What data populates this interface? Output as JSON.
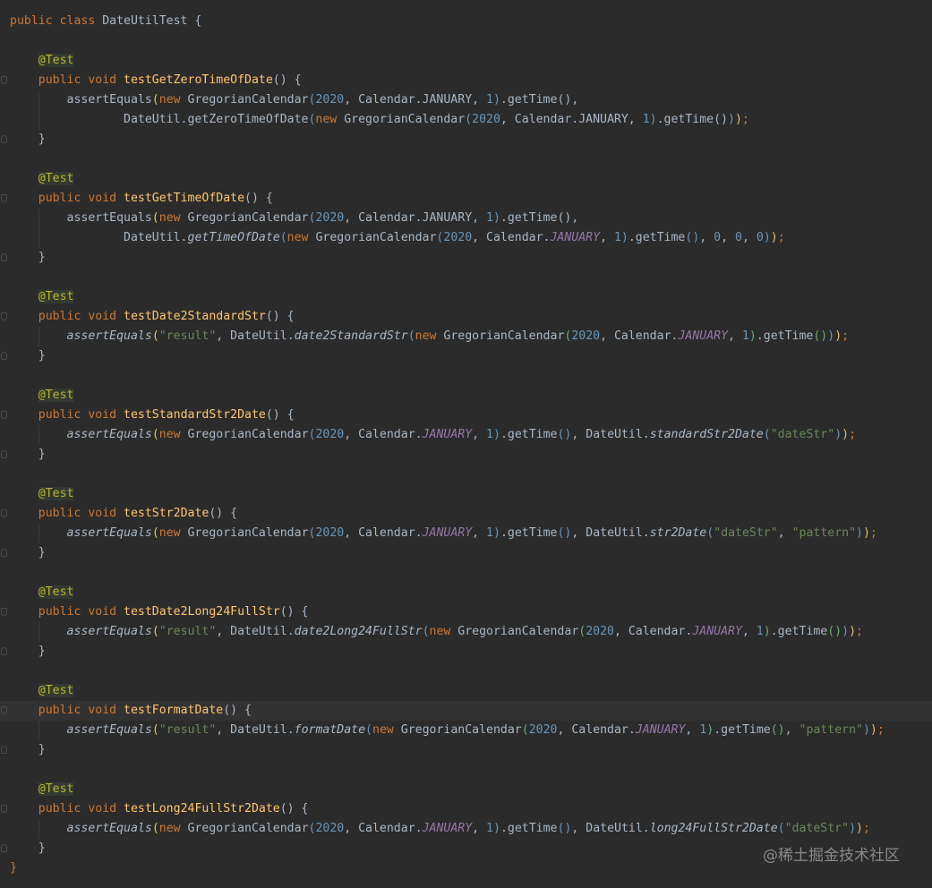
{
  "editor": {
    "current_line": 35,
    "lines": [
      [
        {
          "t": "public class ",
          "c": "keyword"
        },
        {
          "t": "DateUtilTest {",
          "c": "plain"
        }
      ],
      [],
      [
        {
          "t": "    "
        },
        {
          "t": "@Test",
          "c": "annotation"
        }
      ],
      [
        {
          "t": "    "
        },
        {
          "t": "public void ",
          "c": "keyword"
        },
        {
          "t": "testGetZeroTimeOfDate",
          "c": "method"
        },
        {
          "t": "() {",
          "c": "plain"
        }
      ],
      [
        {
          "t": "        assertEquals",
          "c": "plain"
        },
        {
          "t": "(",
          "c": "paren1"
        },
        {
          "t": "new ",
          "c": "keyword"
        },
        {
          "t": "GregorianCalendar",
          "c": "plain"
        },
        {
          "t": "(",
          "c": "paren2"
        },
        {
          "t": "2020",
          "c": "number"
        },
        {
          "t": ", Calendar.JANUARY, ",
          "c": "plain"
        },
        {
          "t": "1",
          "c": "number"
        },
        {
          "t": ")",
          "c": "paren2"
        },
        {
          "t": ".getTime(),",
          "c": "plain"
        }
      ],
      [
        {
          "t": "                DateUtil.getZeroTimeOfDate",
          "c": "plain"
        },
        {
          "t": "(",
          "c": "paren2"
        },
        {
          "t": "new ",
          "c": "keyword"
        },
        {
          "t": "GregorianCalendar",
          "c": "plain"
        },
        {
          "t": "(",
          "c": "paren2"
        },
        {
          "t": "2020",
          "c": "number"
        },
        {
          "t": ", Calendar.JANUARY, ",
          "c": "plain"
        },
        {
          "t": "1",
          "c": "number"
        },
        {
          "t": ")",
          "c": "paren2"
        },
        {
          "t": ".getTime()",
          "c": "plain"
        },
        {
          "t": ")",
          "c": "paren2"
        },
        {
          "t": ")",
          "c": "paren1"
        },
        {
          "t": ";",
          "c": "keyword"
        }
      ],
      [
        {
          "t": "    }",
          "c": "plain"
        }
      ],
      [],
      [
        {
          "t": "    "
        },
        {
          "t": "@Test",
          "c": "annotation"
        }
      ],
      [
        {
          "t": "    "
        },
        {
          "t": "public void ",
          "c": "keyword"
        },
        {
          "t": "testGetTimeOfDate",
          "c": "method"
        },
        {
          "t": "() {",
          "c": "plain"
        }
      ],
      [
        {
          "t": "        assertEquals",
          "c": "plain"
        },
        {
          "t": "(",
          "c": "paren1"
        },
        {
          "t": "new ",
          "c": "keyword"
        },
        {
          "t": "GregorianCalendar",
          "c": "plain"
        },
        {
          "t": "(",
          "c": "paren2"
        },
        {
          "t": "2020",
          "c": "number"
        },
        {
          "t": ", Calendar.JANUARY, ",
          "c": "plain"
        },
        {
          "t": "1",
          "c": "number"
        },
        {
          "t": ")",
          "c": "paren2"
        },
        {
          "t": ".getTime(),",
          "c": "plain"
        }
      ],
      [
        {
          "t": "                DateUtil.",
          "c": "plain"
        },
        {
          "t": "getTimeOfDate",
          "c": "static-method"
        },
        {
          "t": "(",
          "c": "paren2"
        },
        {
          "t": "new ",
          "c": "keyword"
        },
        {
          "t": "GregorianCalendar",
          "c": "plain"
        },
        {
          "t": "(",
          "c": "paren2"
        },
        {
          "t": "2020",
          "c": "number"
        },
        {
          "t": ", Calendar.",
          "c": "plain"
        },
        {
          "t": "JANUARY",
          "c": "static-field"
        },
        {
          "t": ", ",
          "c": "plain"
        },
        {
          "t": "1",
          "c": "number"
        },
        {
          "t": ")",
          "c": "paren2"
        },
        {
          "t": ".getTime",
          "c": "plain"
        },
        {
          "t": "()",
          "c": "paren2"
        },
        {
          "t": ", ",
          "c": "plain"
        },
        {
          "t": "0",
          "c": "number"
        },
        {
          "t": ", ",
          "c": "plain"
        },
        {
          "t": "0",
          "c": "number"
        },
        {
          "t": ", ",
          "c": "plain"
        },
        {
          "t": "0",
          "c": "number"
        },
        {
          "t": ")",
          "c": "paren2"
        },
        {
          "t": ")",
          "c": "paren1"
        },
        {
          "t": ";",
          "c": "keyword"
        }
      ],
      [
        {
          "t": "    }",
          "c": "plain"
        }
      ],
      [],
      [
        {
          "t": "    "
        },
        {
          "t": "@Test",
          "c": "annotation"
        }
      ],
      [
        {
          "t": "    "
        },
        {
          "t": "public void ",
          "c": "keyword"
        },
        {
          "t": "testDate2StandardStr",
          "c": "method"
        },
        {
          "t": "() {",
          "c": "plain"
        }
      ],
      [
        {
          "t": "        "
        },
        {
          "t": "assertEquals",
          "c": "static-method"
        },
        {
          "t": "(",
          "c": "paren1"
        },
        {
          "t": "\"result\"",
          "c": "string"
        },
        {
          "t": ", DateUtil.",
          "c": "plain"
        },
        {
          "t": "date2StandardStr",
          "c": "static-method"
        },
        {
          "t": "(",
          "c": "paren2"
        },
        {
          "t": "new ",
          "c": "keyword"
        },
        {
          "t": "GregorianCalendar",
          "c": "plain"
        },
        {
          "t": "(",
          "c": "paren3"
        },
        {
          "t": "2020",
          "c": "number"
        },
        {
          "t": ", Calendar.",
          "c": "plain"
        },
        {
          "t": "JANUARY",
          "c": "static-field"
        },
        {
          "t": ", ",
          "c": "plain"
        },
        {
          "t": "1",
          "c": "number"
        },
        {
          "t": ")",
          "c": "paren3"
        },
        {
          "t": ".getTime",
          "c": "plain"
        },
        {
          "t": "()",
          "c": "paren3"
        },
        {
          "t": ")",
          "c": "paren2"
        },
        {
          "t": ")",
          "c": "paren1"
        },
        {
          "t": ";",
          "c": "keyword"
        }
      ],
      [
        {
          "t": "    }",
          "c": "plain"
        }
      ],
      [],
      [
        {
          "t": "    "
        },
        {
          "t": "@Test",
          "c": "annotation"
        }
      ],
      [
        {
          "t": "    "
        },
        {
          "t": "public void ",
          "c": "keyword"
        },
        {
          "t": "testStandardStr2Date",
          "c": "method"
        },
        {
          "t": "() {",
          "c": "plain"
        }
      ],
      [
        {
          "t": "        "
        },
        {
          "t": "assertEquals",
          "c": "static-method"
        },
        {
          "t": "(",
          "c": "paren1"
        },
        {
          "t": "new ",
          "c": "keyword"
        },
        {
          "t": "GregorianCalendar",
          "c": "plain"
        },
        {
          "t": "(",
          "c": "paren2"
        },
        {
          "t": "2020",
          "c": "number"
        },
        {
          "t": ", Calendar.",
          "c": "plain"
        },
        {
          "t": "JANUARY",
          "c": "static-field"
        },
        {
          "t": ", ",
          "c": "plain"
        },
        {
          "t": "1",
          "c": "number"
        },
        {
          "t": ")",
          "c": "paren2"
        },
        {
          "t": ".getTime",
          "c": "plain"
        },
        {
          "t": "()",
          "c": "paren2"
        },
        {
          "t": ", DateUtil.",
          "c": "plain"
        },
        {
          "t": "standardStr2Date",
          "c": "static-method"
        },
        {
          "t": "(",
          "c": "paren2"
        },
        {
          "t": "\"dateStr\"",
          "c": "string"
        },
        {
          "t": ")",
          "c": "paren2"
        },
        {
          "t": ")",
          "c": "paren1"
        },
        {
          "t": ";",
          "c": "keyword"
        }
      ],
      [
        {
          "t": "    }",
          "c": "plain"
        }
      ],
      [],
      [
        {
          "t": "    "
        },
        {
          "t": "@Test",
          "c": "annotation"
        }
      ],
      [
        {
          "t": "    "
        },
        {
          "t": "public void ",
          "c": "keyword"
        },
        {
          "t": "testStr2Date",
          "c": "method"
        },
        {
          "t": "() {",
          "c": "plain"
        }
      ],
      [
        {
          "t": "        "
        },
        {
          "t": "assertEquals",
          "c": "static-method"
        },
        {
          "t": "(",
          "c": "paren1"
        },
        {
          "t": "new ",
          "c": "keyword"
        },
        {
          "t": "GregorianCalendar",
          "c": "plain"
        },
        {
          "t": "(",
          "c": "paren2"
        },
        {
          "t": "2020",
          "c": "number"
        },
        {
          "t": ", Calendar.",
          "c": "plain"
        },
        {
          "t": "JANUARY",
          "c": "static-field"
        },
        {
          "t": ", ",
          "c": "plain"
        },
        {
          "t": "1",
          "c": "number"
        },
        {
          "t": ")",
          "c": "paren2"
        },
        {
          "t": ".getTime",
          "c": "plain"
        },
        {
          "t": "()",
          "c": "paren2"
        },
        {
          "t": ", DateUtil.",
          "c": "plain"
        },
        {
          "t": "str2Date",
          "c": "static-method"
        },
        {
          "t": "(",
          "c": "paren2"
        },
        {
          "t": "\"dateStr\"",
          "c": "string"
        },
        {
          "t": ", ",
          "c": "plain"
        },
        {
          "t": "\"pattern\"",
          "c": "string"
        },
        {
          "t": ")",
          "c": "paren2"
        },
        {
          "t": ")",
          "c": "paren1"
        },
        {
          "t": ";",
          "c": "keyword"
        }
      ],
      [
        {
          "t": "    }",
          "c": "plain"
        }
      ],
      [],
      [
        {
          "t": "    "
        },
        {
          "t": "@Test",
          "c": "annotation"
        }
      ],
      [
        {
          "t": "    "
        },
        {
          "t": "public void ",
          "c": "keyword"
        },
        {
          "t": "testDate2Long24FullStr",
          "c": "method"
        },
        {
          "t": "() {",
          "c": "plain"
        }
      ],
      [
        {
          "t": "        "
        },
        {
          "t": "assertEquals",
          "c": "static-method"
        },
        {
          "t": "(",
          "c": "paren1"
        },
        {
          "t": "\"result\"",
          "c": "string"
        },
        {
          "t": ", DateUtil.",
          "c": "plain"
        },
        {
          "t": "date2Long24FullStr",
          "c": "static-method"
        },
        {
          "t": "(",
          "c": "paren2"
        },
        {
          "t": "new ",
          "c": "keyword"
        },
        {
          "t": "GregorianCalendar",
          "c": "plain"
        },
        {
          "t": "(",
          "c": "paren3"
        },
        {
          "t": "2020",
          "c": "number"
        },
        {
          "t": ", Calendar.",
          "c": "plain"
        },
        {
          "t": "JANUARY",
          "c": "static-field"
        },
        {
          "t": ", ",
          "c": "plain"
        },
        {
          "t": "1",
          "c": "number"
        },
        {
          "t": ")",
          "c": "paren3"
        },
        {
          "t": ".getTime",
          "c": "plain"
        },
        {
          "t": "()",
          "c": "paren3"
        },
        {
          "t": ")",
          "c": "paren2"
        },
        {
          "t": ")",
          "c": "paren1"
        },
        {
          "t": ";",
          "c": "keyword"
        }
      ],
      [
        {
          "t": "    }",
          "c": "plain"
        }
      ],
      [],
      [
        {
          "t": "    "
        },
        {
          "t": "@Test",
          "c": "annotation"
        }
      ],
      [
        {
          "t": "    "
        },
        {
          "t": "public void ",
          "c": "keyword"
        },
        {
          "t": "testFormatDate",
          "c": "method"
        },
        {
          "t": "() {",
          "c": "plain"
        }
      ],
      [
        {
          "t": "        "
        },
        {
          "t": "assertEquals",
          "c": "static-method"
        },
        {
          "t": "(",
          "c": "paren1"
        },
        {
          "t": "\"result\"",
          "c": "string"
        },
        {
          "t": ", DateUtil.",
          "c": "plain"
        },
        {
          "t": "formatDate",
          "c": "static-method"
        },
        {
          "t": "(",
          "c": "paren2"
        },
        {
          "t": "new ",
          "c": "keyword"
        },
        {
          "t": "GregorianCalendar",
          "c": "plain"
        },
        {
          "t": "(",
          "c": "paren3"
        },
        {
          "t": "2020",
          "c": "number"
        },
        {
          "t": ", Calendar.",
          "c": "plain"
        },
        {
          "t": "JANUARY",
          "c": "static-field"
        },
        {
          "t": ", ",
          "c": "plain"
        },
        {
          "t": "1",
          "c": "number"
        },
        {
          "t": ")",
          "c": "paren3"
        },
        {
          "t": ".getTime",
          "c": "plain"
        },
        {
          "t": "()",
          "c": "paren3"
        },
        {
          "t": ", ",
          "c": "plain"
        },
        {
          "t": "\"pattern\"",
          "c": "string"
        },
        {
          "t": ")",
          "c": "paren2"
        },
        {
          "t": ")",
          "c": "paren1"
        },
        {
          "t": ";",
          "c": "keyword"
        }
      ],
      [
        {
          "t": "    }",
          "c": "plain"
        }
      ],
      [],
      [
        {
          "t": "    "
        },
        {
          "t": "@Test",
          "c": "annotation"
        }
      ],
      [
        {
          "t": "    "
        },
        {
          "t": "public void ",
          "c": "keyword"
        },
        {
          "t": "testLong24FullStr2Date",
          "c": "method"
        },
        {
          "t": "() {",
          "c": "plain"
        }
      ],
      [
        {
          "t": "        "
        },
        {
          "t": "assertEquals",
          "c": "static-method"
        },
        {
          "t": "(",
          "c": "paren1"
        },
        {
          "t": "new ",
          "c": "keyword"
        },
        {
          "t": "GregorianCalendar",
          "c": "plain"
        },
        {
          "t": "(",
          "c": "paren2"
        },
        {
          "t": "2020",
          "c": "number"
        },
        {
          "t": ", Calendar.",
          "c": "plain"
        },
        {
          "t": "JANUARY",
          "c": "static-field"
        },
        {
          "t": ", ",
          "c": "plain"
        },
        {
          "t": "1",
          "c": "number"
        },
        {
          "t": ")",
          "c": "paren2"
        },
        {
          "t": ".getTime",
          "c": "plain"
        },
        {
          "t": "()",
          "c": "paren2"
        },
        {
          "t": ", DateUtil.",
          "c": "plain"
        },
        {
          "t": "long24FullStr2Date",
          "c": "static-method"
        },
        {
          "t": "(",
          "c": "paren2"
        },
        {
          "t": "\"dateStr\"",
          "c": "string"
        },
        {
          "t": ")",
          "c": "paren2"
        },
        {
          "t": ")",
          "c": "paren1"
        },
        {
          "t": ";",
          "c": "keyword"
        }
      ],
      [
        {
          "t": "    }",
          "c": "plain"
        }
      ],
      [
        {
          "t": "}",
          "c": "keyword"
        }
      ]
    ]
  },
  "watermark": {
    "text": "@稀土掘金技术社区"
  },
  "colors": {
    "background": "#2b2b2b",
    "keyword": "#cc7832",
    "annotation": "#bbb529",
    "method": "#ffc66d",
    "number": "#6897bb",
    "string": "#6a8759",
    "static_field": "#9876aa",
    "text": "#a9b7c6"
  }
}
